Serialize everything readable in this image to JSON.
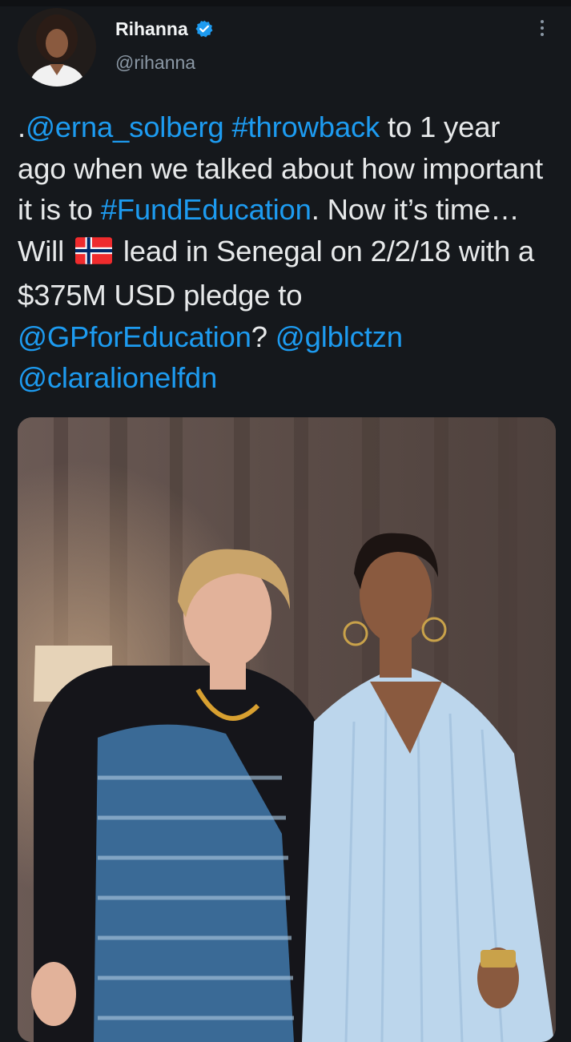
{
  "author": {
    "display_name": "Rihanna",
    "handle": "@rihanna",
    "verified": true,
    "avatar_icon": "profile-photo"
  },
  "tweet": {
    "segments": [
      {
        "text": ".",
        "type": "text"
      },
      {
        "text": "@erna_solberg",
        "type": "mention"
      },
      {
        "text": " ",
        "type": "text"
      },
      {
        "text": "#throwback",
        "type": "hashtag"
      },
      {
        "text": " to 1 year ago when we talked about how important it is to ",
        "type": "text"
      },
      {
        "text": "#FundEducation",
        "type": "hashtag"
      },
      {
        "text": ". Now it’s time… Will ",
        "type": "text"
      },
      {
        "text": "🇳🇴",
        "type": "emoji"
      },
      {
        "text": " lead in Senegal on 2/2/18 with a $375M USD pledge to ",
        "type": "text"
      },
      {
        "text": "@GPforEducation",
        "type": "mention"
      },
      {
        "text": "? ",
        "type": "text"
      },
      {
        "text": "@glblctzn",
        "type": "mention"
      },
      {
        "text": " ",
        "type": "text"
      },
      {
        "text": "@claralionelfdn",
        "type": "mention"
      }
    ]
  },
  "menu": {
    "icon": "more-vertical-icon"
  },
  "media": {
    "type": "photo"
  },
  "colors": {
    "background": "#15181c",
    "link": "#1d9bf0",
    "text": "#e7e9ea",
    "secondary": "#8b98a5",
    "verified": "#1d9bf0"
  }
}
